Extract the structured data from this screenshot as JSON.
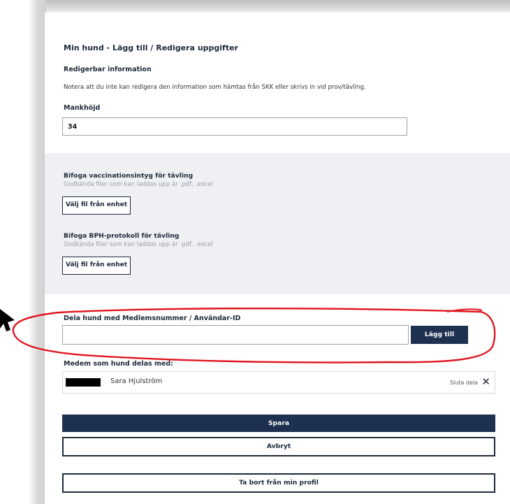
{
  "form": {
    "title": "Min hund - Lägg till / Redigera uppgifter",
    "section_title": "Redigerbar information",
    "note": "Notera att du inte kan redigera den information som hämtas från SKK eller skrivs in vid prov/tävling.",
    "height_label": "Mankhöjd",
    "height_value": "34"
  },
  "attachments": {
    "vaccination_title": "Bifoga vaccinationsintyg för tävling",
    "vaccination_hint": "Godkända filer som kan laddas upp är .pdf, .excel",
    "vaccination_button": "Välj fil från enhet",
    "bph_title": "Bifoga BPH-protokoll för tävling",
    "bph_hint": "Godkända filer som kan laddas upp är .pdf, .excel",
    "bph_button": "Välj fil från enhet"
  },
  "share": {
    "label": "Dela hund med Medlemsnummer / Användar-ID",
    "input_value": "",
    "add_button": "Lägg till",
    "members_label": "Medem som hund delas med:",
    "members": [
      {
        "name": "Sara Hjulström",
        "stop_label": "Sluta dela"
      }
    ]
  },
  "actions": {
    "save": "Spara",
    "cancel": "Avbryt",
    "remove": "Ta bort från min profil"
  },
  "colors": {
    "primary": "#1e3050",
    "annotation": "#e0141e",
    "section_bg": "#eef0f4"
  }
}
